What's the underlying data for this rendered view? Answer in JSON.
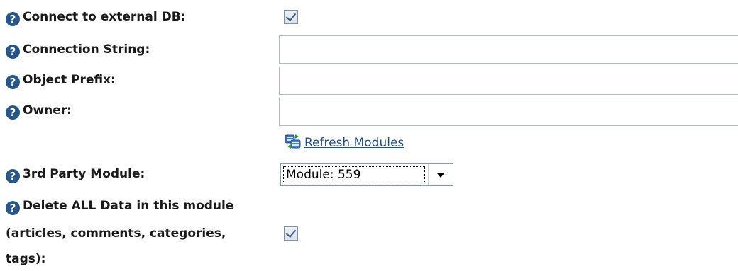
{
  "fields": {
    "connect_external_db": {
      "label": "Connect to external DB:",
      "checked": true
    },
    "connection_string": {
      "label": "Connection String:",
      "value": ""
    },
    "object_prefix": {
      "label": "Object Prefix:",
      "value": ""
    },
    "owner": {
      "label": "Owner:",
      "value": ""
    },
    "refresh_modules": {
      "label": "Refresh Modules",
      "icon": "refresh-modules-icon"
    },
    "third_party_module": {
      "label": "3rd Party Module:",
      "selected": "Module: 559"
    },
    "delete_all_data": {
      "label_lines": [
        "Delete ALL Data in this module",
        "(articles, comments, categories,",
        "tags):"
      ],
      "checked": true
    }
  },
  "help_icon": "question-mark-icon",
  "colors": {
    "help_icon_bg": "#27578a",
    "link": "#1e4d8e",
    "label_text": "#1a1a1a"
  }
}
